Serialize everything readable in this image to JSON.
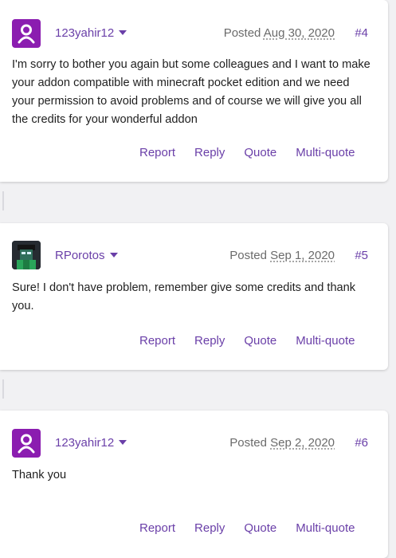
{
  "posts": [
    {
      "username": "123yahir12",
      "posted_label": "Posted",
      "date": "Aug 30, 2020",
      "number": "#4",
      "avatar": "user-silhouette-icon",
      "body": "I'm sorry to bother you again but some colleagues and I want to make your addon compatible with minecraft pocket edition and we need your permission to avoid problems and of course we will give you all the credits for your wonderful addon",
      "actions": [
        "Report",
        "Reply",
        "Quote",
        "Multi-quote"
      ]
    },
    {
      "username": "RPorotos",
      "posted_label": "Posted",
      "date": "Sep 1, 2020",
      "number": "#5",
      "avatar": "character-avatar-image",
      "body": "Sure! I don't have problem, remember give some credits and thank you.",
      "actions": [
        "Report",
        "Reply",
        "Quote",
        "Multi-quote"
      ]
    },
    {
      "username": "123yahir12",
      "posted_label": "Posted",
      "date": "Sep 2, 2020",
      "number": "#6",
      "avatar": "user-silhouette-icon",
      "body": "Thank you",
      "actions": [
        "Report",
        "Reply",
        "Quote",
        "Multi-quote"
      ]
    }
  ],
  "colors": {
    "accent": "#6a3fa8",
    "avatar_bg": "#8b1db0",
    "page_bg": "#f1f1f3"
  }
}
